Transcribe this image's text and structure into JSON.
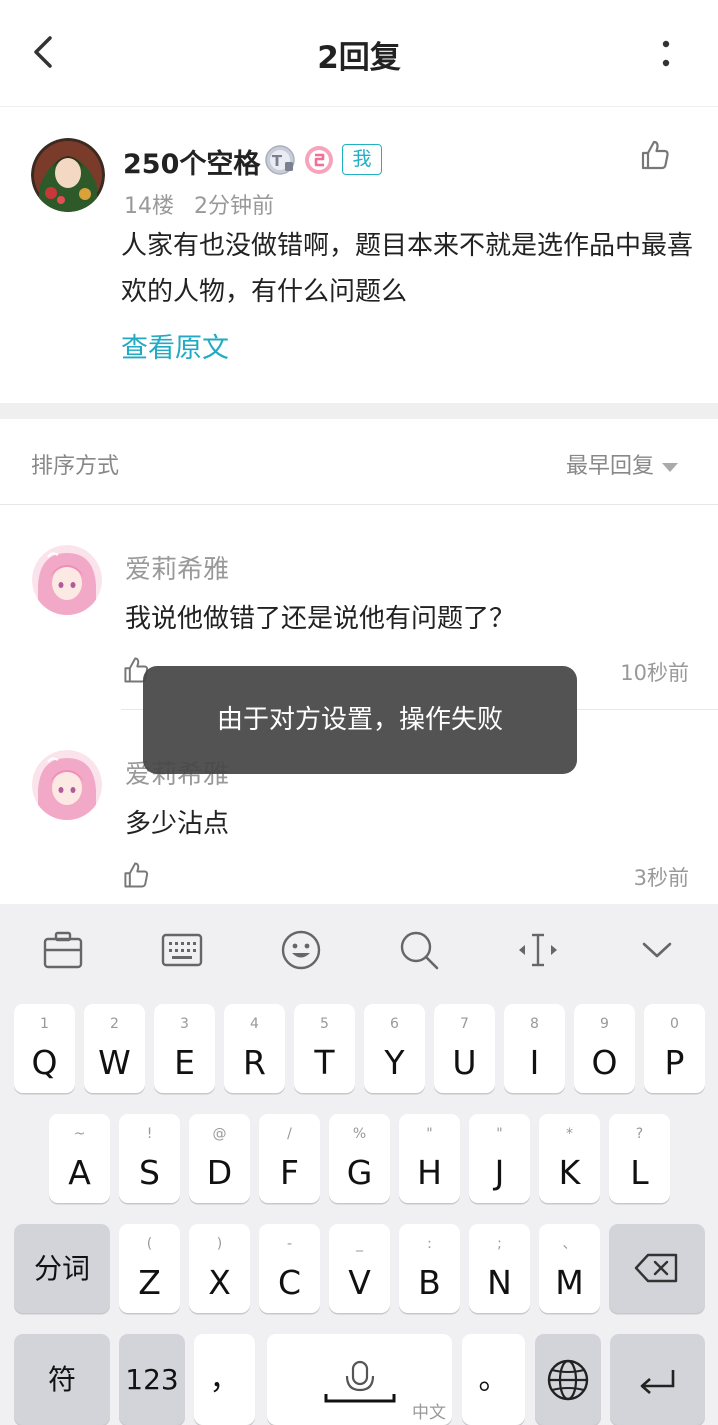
{
  "header": {
    "title": "2回复"
  },
  "post": {
    "username": "250个空格",
    "badge_t": "T",
    "badge_me": "我",
    "floor": "14楼",
    "time": "2分钟前",
    "text": "人家有也没做错啊，题目本来不就是选作品中最喜欢的人物，有什么问题么",
    "view_original": "查看原文"
  },
  "sort": {
    "label": "排序方式",
    "value": "最早回复"
  },
  "replies": [
    {
      "name": "爱莉希雅",
      "text": "我说他做错了还是说他有问题了？",
      "time": "10秒前"
    },
    {
      "name": "爱莉希雅",
      "text": "多少沾点",
      "time": "3秒前"
    }
  ],
  "toast": {
    "text": "由于对方设置，操作失败"
  },
  "keyboard": {
    "row1": [
      {
        "main": "Q",
        "sub": "1"
      },
      {
        "main": "W",
        "sub": "2"
      },
      {
        "main": "E",
        "sub": "3"
      },
      {
        "main": "R",
        "sub": "4"
      },
      {
        "main": "T",
        "sub": "5"
      },
      {
        "main": "Y",
        "sub": "6"
      },
      {
        "main": "U",
        "sub": "7"
      },
      {
        "main": "I",
        "sub": "8"
      },
      {
        "main": "O",
        "sub": "9"
      },
      {
        "main": "P",
        "sub": "0"
      }
    ],
    "row2": [
      {
        "main": "A",
        "sub": "~"
      },
      {
        "main": "S",
        "sub": "!"
      },
      {
        "main": "D",
        "sub": "@"
      },
      {
        "main": "F",
        "sub": "/"
      },
      {
        "main": "G",
        "sub": "%"
      },
      {
        "main": "H",
        "sub": "\""
      },
      {
        "main": "J",
        "sub": "\""
      },
      {
        "main": "K",
        "sub": "*"
      },
      {
        "main": "L",
        "sub": "?"
      }
    ],
    "row3": [
      {
        "main": "Z",
        "sub": "("
      },
      {
        "main": "X",
        "sub": ")"
      },
      {
        "main": "C",
        "sub": "-"
      },
      {
        "main": "V",
        "sub": "_"
      },
      {
        "main": "B",
        "sub": ":"
      },
      {
        "main": "N",
        "sub": ";"
      },
      {
        "main": "M",
        "sub": "、"
      }
    ],
    "segment": "分词",
    "symbols": "符",
    "numbers": "123",
    "comma": "，",
    "period": "。",
    "space_label": "中文"
  }
}
